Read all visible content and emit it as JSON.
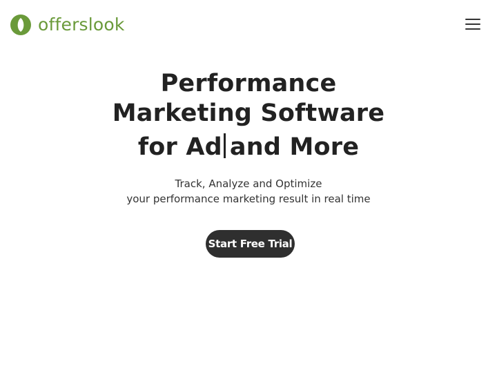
{
  "header": {
    "logo_text": "offerslook",
    "brand_color": "#6a9a3a",
    "menu_icon": "hamburger-menu-icon"
  },
  "hero": {
    "title_line1": "Performance",
    "title_line2": "Marketing Software",
    "title_line3_prefix": "for Ad",
    "title_line3_suffix": "and More",
    "subtitle_line1": "Track, Analyze and Optimize",
    "subtitle_line2": "your performance marketing result in real time",
    "cta_label": "Start Free Trial",
    "cta_color": "#2f2f2f"
  }
}
